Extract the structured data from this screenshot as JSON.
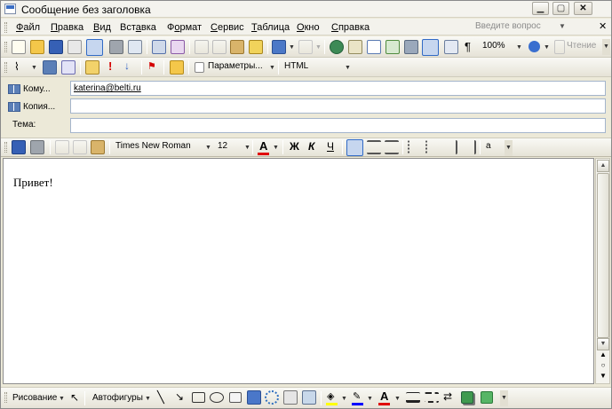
{
  "window": {
    "title": "Сообщение без заголовка"
  },
  "menu": {
    "items": [
      {
        "pre": "",
        "ul": "Ф",
        "post": "айл"
      },
      {
        "pre": "",
        "ul": "П",
        "post": "равка"
      },
      {
        "pre": "",
        "ul": "В",
        "post": "ид"
      },
      {
        "pre": "Вст",
        "ul": "а",
        "post": "вка"
      },
      {
        "pre": "Ф",
        "ul": "о",
        "post": "рмат"
      },
      {
        "pre": "",
        "ul": "С",
        "post": "ервис"
      },
      {
        "pre": "",
        "ul": "Т",
        "post": "аблица"
      },
      {
        "pre": "",
        "ul": "О",
        "post": "кно"
      },
      {
        "pre": "",
        "ul": "С",
        "post": "правка"
      }
    ],
    "ask_placeholder": "Введите вопрос"
  },
  "standard_toolbar": {
    "zoom": "100%",
    "reading_label": "Чтение"
  },
  "email_toolbar": {
    "options_label": "Параметры...",
    "format_value": "HTML"
  },
  "header": {
    "to_label": "Кому...",
    "to_value": "katerina@belti.ru",
    "cc_label": "Копия...",
    "cc_value": "",
    "subject_label": "Тема:",
    "subject_value": ""
  },
  "formatting": {
    "font_name": "Times New Roman",
    "font_size": "12",
    "bold": "Ж",
    "italic": "К",
    "underline": "Ч"
  },
  "message": {
    "body_text": "Привет!"
  },
  "drawing": {
    "draw_label": "Рисование",
    "autoshapes_label": "Автофигуры"
  },
  "colors": {
    "accent": "#316ac5",
    "font_color": "#e00000",
    "highlight": "#ffff00",
    "line_color": "#0000ff",
    "fill_color": "#ffff00"
  }
}
